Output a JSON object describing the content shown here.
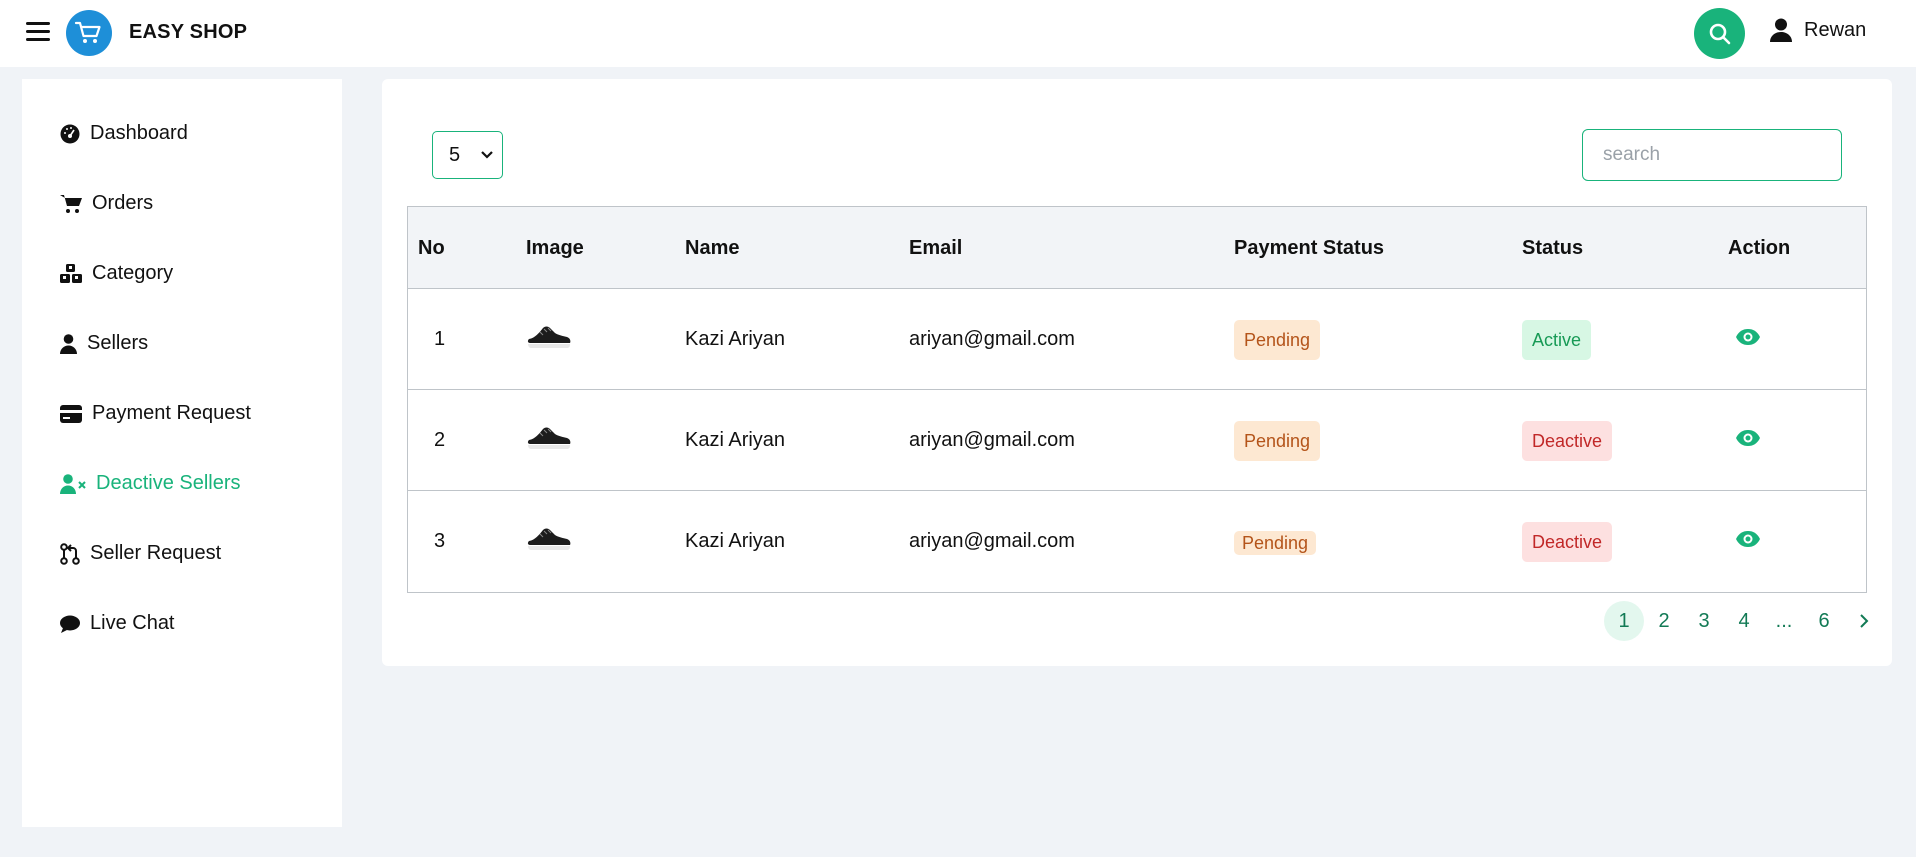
{
  "header": {
    "brand": "EASY SHOP",
    "user_name": "Rewan",
    "colors": {
      "accent": "#19b37b",
      "logo": "#1e8fd8"
    }
  },
  "sidebar": {
    "items": [
      {
        "label": "Dashboard",
        "icon": "dashboard-icon"
      },
      {
        "label": "Orders",
        "icon": "cart-icon"
      },
      {
        "label": "Category",
        "icon": "cubes-icon"
      },
      {
        "label": "Sellers",
        "icon": "user-icon"
      },
      {
        "label": "Payment Request",
        "icon": "credit-card-icon"
      },
      {
        "label": "Deactive Sellers",
        "icon": "user-x-icon",
        "active": true
      },
      {
        "label": "Seller Request",
        "icon": "git-pull-request-icon"
      },
      {
        "label": "Live Chat",
        "icon": "chat-icon"
      }
    ]
  },
  "controls": {
    "page_size": "5",
    "search_placeholder": "search"
  },
  "table": {
    "headers": [
      "No",
      "Image",
      "Name",
      "Email",
      "Payment Status",
      "Status",
      "Action"
    ],
    "rows": [
      {
        "no": "1",
        "image": "shoe-thumbnail",
        "name": "Kazi Ariyan",
        "email": "ariyan@gmail.com",
        "payment_status": "Pending",
        "status": "Active"
      },
      {
        "no": "2",
        "image": "shoe-thumbnail",
        "name": "Kazi Ariyan",
        "email": "ariyan@gmail.com",
        "payment_status": "Pending",
        "status": "Deactive"
      },
      {
        "no": "3",
        "image": "shoe-thumbnail",
        "name": "Kazi Ariyan",
        "email": "ariyan@gmail.com",
        "payment_status": "Pending",
        "status": "Deactive"
      }
    ]
  },
  "pagination": {
    "pages": [
      "1",
      "2",
      "3",
      "4",
      "...",
      "6"
    ],
    "current": "1",
    "next_icon": "chevron-right-icon"
  }
}
